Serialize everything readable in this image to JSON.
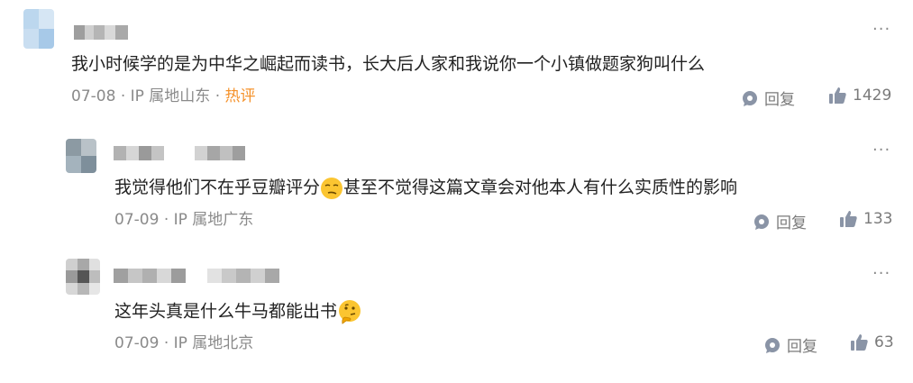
{
  "comments": [
    {
      "text": "我小时候学的是为中华之崛起而读书，长大后人家和我说你一个小镇做题家狗叫什么",
      "date": "07-08",
      "ip_location": "IP 属地山东",
      "tag": "热评",
      "reply_label": "回复",
      "likes": "1429"
    },
    {
      "text_before_emoji": "我觉得他们不在乎豆瓣评分",
      "emoji": "smirk-face-icon",
      "text_after_emoji": "甚至不觉得这篇文章会对他本人有什么实质性的影响",
      "date": "07-09",
      "ip_location": "IP 属地广东",
      "reply_label": "回复",
      "likes": "133"
    },
    {
      "text": "这年头真是什么牛马都能出书",
      "emoji": "thinking-face-icon",
      "date": "07-09",
      "ip_location": "IP 属地北京",
      "reply_label": "回复",
      "likes": "63"
    }
  ],
  "colors": {
    "hot_tag": "#f5922b",
    "meta_gray": "#8a8a8a",
    "icon_gray": "#8a94a6"
  },
  "icons": {
    "more": "more-dots-icon",
    "reply": "chat-bubble-icon",
    "like": "thumbs-up-icon"
  }
}
